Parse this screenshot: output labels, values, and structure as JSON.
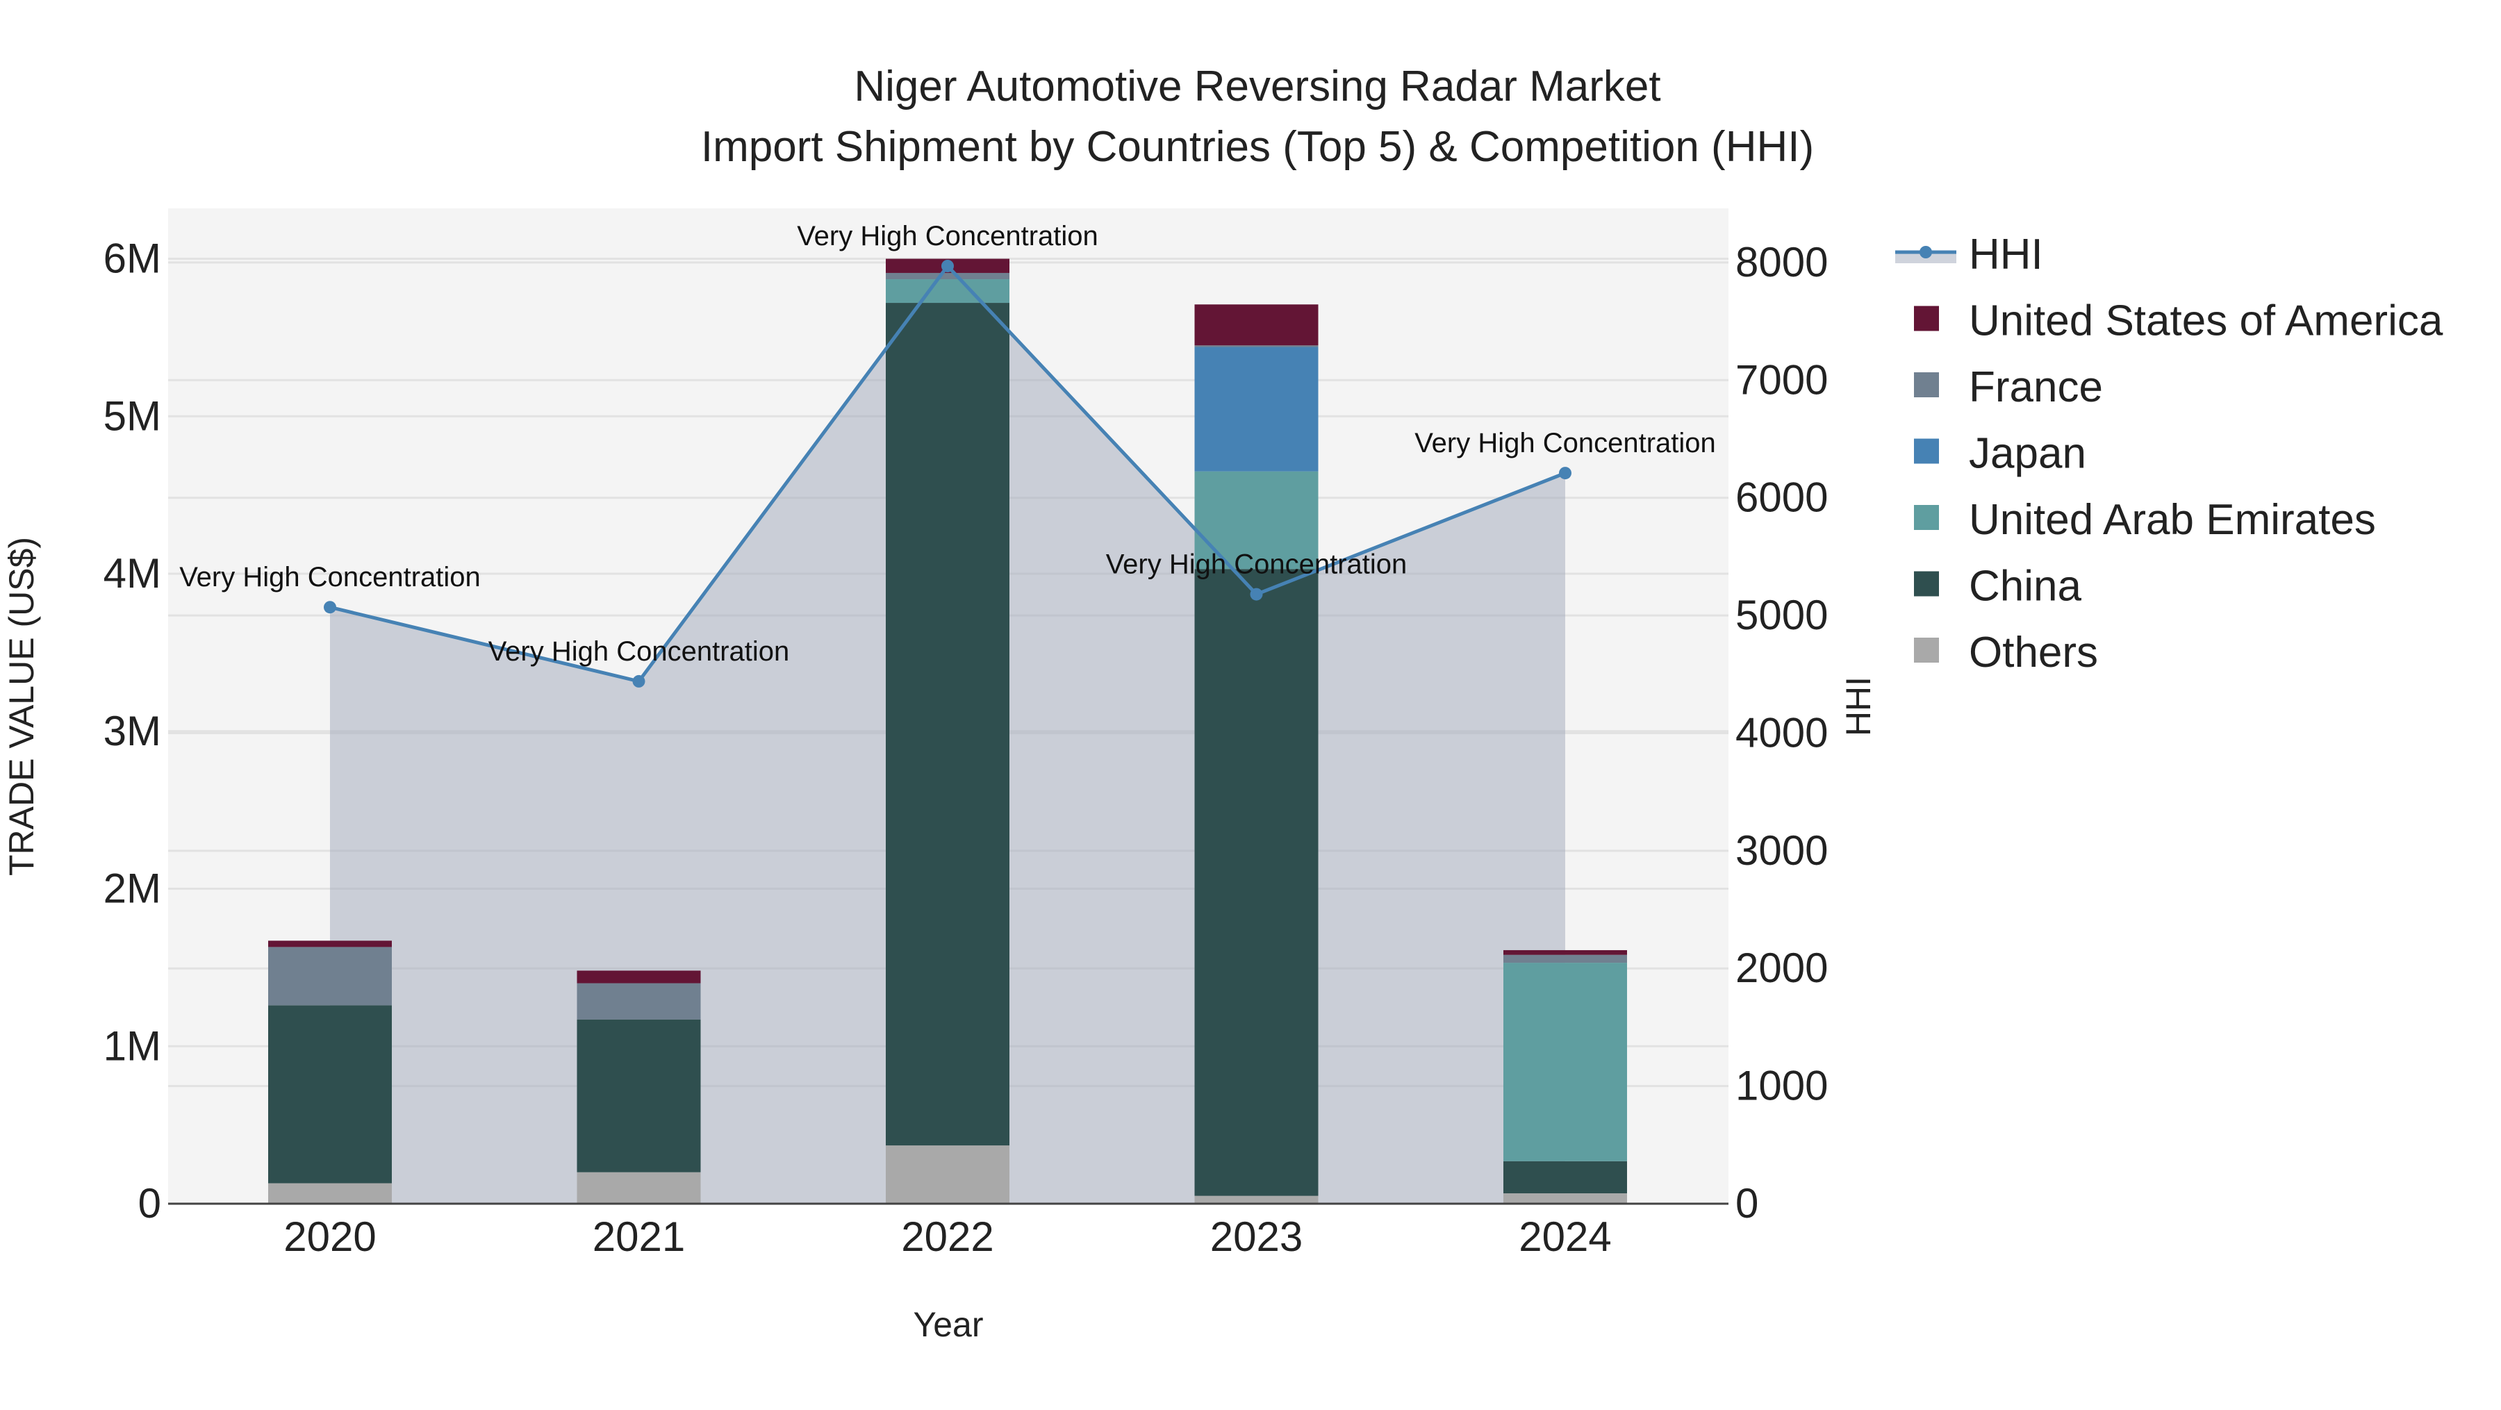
{
  "chart_data": {
    "type": "bar",
    "title": "Niger Automotive Reversing Radar Market",
    "subtitle": "Import Shipment by Countries (Top 5) & Competition (HHI)",
    "xlabel": "Year",
    "ylabel": "TRADE VALUE (US$)",
    "y2label": "HHI",
    "categories": [
      "2020",
      "2021",
      "2022",
      "2023",
      "2024"
    ],
    "ylim": [
      0,
      6320000
    ],
    "y2lim": [
      0,
      8460
    ],
    "yticks": [
      {
        "v": 0,
        "label": "0"
      },
      {
        "v": 1000000,
        "label": "1M"
      },
      {
        "v": 2000000,
        "label": "2M"
      },
      {
        "v": 3000000,
        "label": "3M"
      },
      {
        "v": 4000000,
        "label": "4M"
      },
      {
        "v": 5000000,
        "label": "5M"
      },
      {
        "v": 6000000,
        "label": "6M"
      }
    ],
    "y2ticks": [
      0,
      1000,
      2000,
      3000,
      4000,
      5000,
      6000,
      7000,
      8000
    ],
    "grid": true,
    "legend_position": "right",
    "stacked_series": [
      {
        "name": "Others",
        "color": "#a9a9a9",
        "values": [
          130000,
          200000,
          370000,
          50000,
          66000
        ]
      },
      {
        "name": "China",
        "color": "#2f4f4f",
        "values": [
          1130000,
          970000,
          5350000,
          3980000,
          204000
        ]
      },
      {
        "name": "United Arab Emirates",
        "color": "#5f9ea0",
        "values": [
          0,
          0,
          150000,
          620000,
          1260000
        ]
      },
      {
        "name": "Japan",
        "color": "#4682b4",
        "values": [
          0,
          0,
          0,
          790000,
          0
        ]
      },
      {
        "name": "France",
        "color": "#708090",
        "values": [
          370000,
          230000,
          40000,
          10000,
          50000
        ]
      },
      {
        "name": "United States of America",
        "color": "#631535",
        "values": [
          40000,
          80000,
          90000,
          260000,
          30000
        ]
      }
    ],
    "line_series": {
      "name": "HHI",
      "color": "#4682b4",
      "values": [
        5070,
        4440,
        7970,
        5180,
        6210
      ],
      "annotations": [
        "Very High Concentration",
        "Very High Concentration",
        "Very High Concentration",
        "Very High Concentration",
        "Very High Concentration"
      ]
    },
    "legend_order": [
      "HHI",
      "United States of America",
      "France",
      "Japan",
      "United Arab Emirates",
      "China",
      "Others"
    ]
  }
}
